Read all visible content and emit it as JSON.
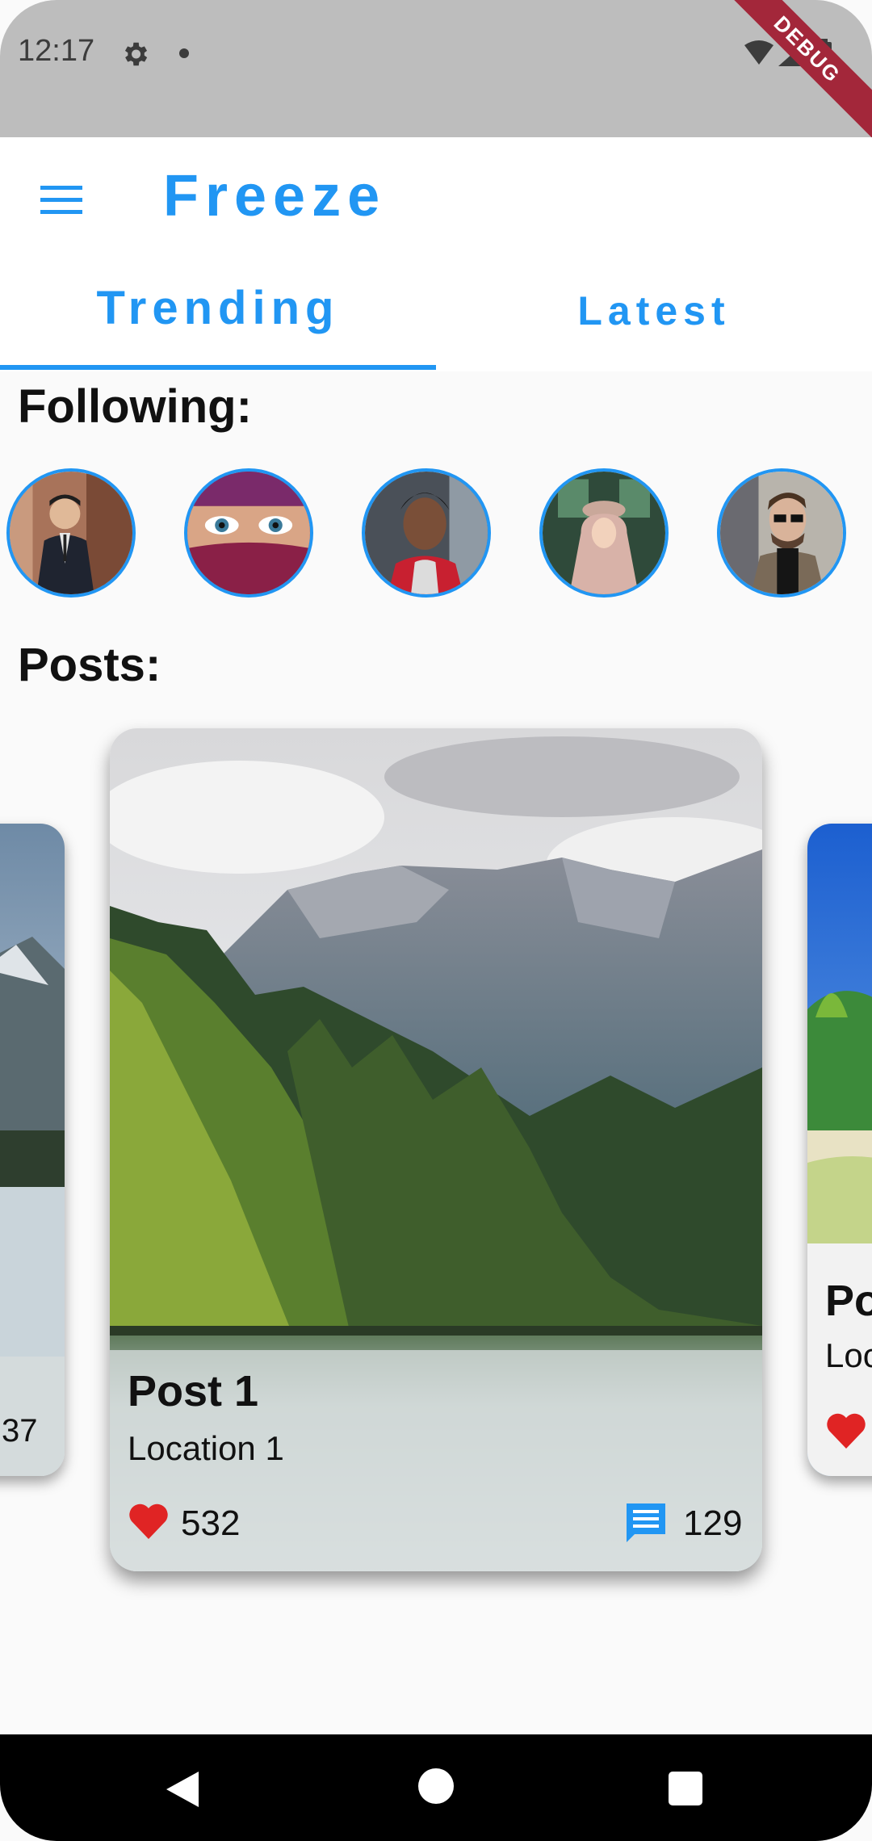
{
  "status_bar": {
    "time": "12:17",
    "icons": [
      "gear-icon",
      "notification-dot-icon",
      "wifi-icon",
      "signal-icon",
      "battery-icon"
    ],
    "debug_banner": "DEBUG"
  },
  "app_bar": {
    "title": "Freeze",
    "menu_icon": "menu-icon"
  },
  "tabs": [
    {
      "label": "Trending",
      "selected": true
    },
    {
      "label": "Latest",
      "selected": false
    }
  ],
  "following": {
    "label": "Following:",
    "avatars": [
      "avatar-man-suit",
      "avatar-woman-veil",
      "avatar-man-curly",
      "avatar-woman-hijab",
      "avatar-man-glasses"
    ]
  },
  "posts": {
    "label": "Posts:",
    "left_card": {
      "likes_partial": "37"
    },
    "main_card": {
      "title": "Post 1",
      "location": "Location 1",
      "likes": "532",
      "comments": "129"
    },
    "right_card": {
      "title_partial": "Po",
      "location_partial": "Loc"
    }
  },
  "colors": {
    "accent": "#2196f3",
    "status_bar": "#bdbdbd",
    "debug_banner": "#a3273a",
    "nav_bar": "#000000"
  },
  "nav_bar": {
    "icons": [
      "back-icon",
      "home-icon",
      "recents-icon"
    ]
  }
}
